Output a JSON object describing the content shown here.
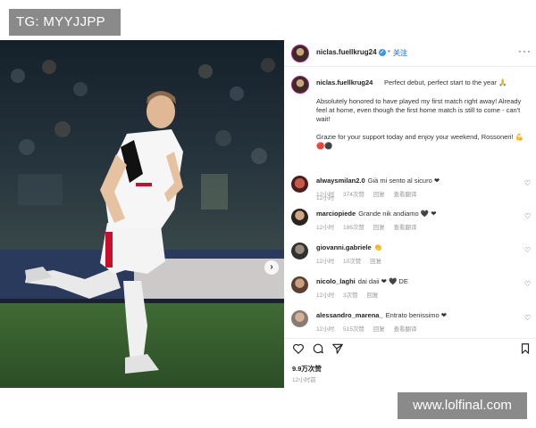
{
  "watermarks": {
    "top": "TG: MYYJJPP",
    "bottom": "www.lolfinal.com"
  },
  "header": {
    "username": "niclas.fuellkrug24",
    "separator": "•",
    "follow_label": "关注",
    "more_icon": "more-horizontal-icon"
  },
  "caption": {
    "username": "niclas.fuellkrug24",
    "first_line": "Perfect debut, perfect start to the year 🙏",
    "paragraph_1": "Absolutely honored to have played my first match right away! Already feel at home, even though the first home match is still to come - can't wait!",
    "paragraph_2": "Grazie for your support today and enjoy your weekend, Rossoneri! 💪🔴⚫",
    "time": "12小时"
  },
  "comments": [
    {
      "username": "alwaysmilan2.0",
      "text": "Già mi sento al sicuro ❤",
      "time": "12小时",
      "likes": "374次赞",
      "reply": "回复",
      "translate": "查看翻译"
    },
    {
      "username": "marciopiede",
      "text": "Grande nik andiamo 🖤 ❤",
      "time": "12小时",
      "likes": "186次赞",
      "reply": "回复",
      "translate": "查看翻译"
    },
    {
      "username": "giovanni.gabriele",
      "text": "👏",
      "time": "12小时",
      "likes": "10次赞",
      "reply": "回复",
      "translate": ""
    },
    {
      "username": "nicolo_laghi",
      "text": "dai daii ❤ 🖤 DE",
      "time": "12小时",
      "likes": "3次赞",
      "reply": "回复",
      "translate": ""
    },
    {
      "username": "alessandro_marena_",
      "text": "Entrato benissimo ❤",
      "time": "12小时",
      "likes": "515次赞",
      "reply": "回复",
      "translate": "查看翻译"
    }
  ],
  "actions": {
    "icons": [
      "heart-icon",
      "comment-icon",
      "share-icon",
      "bookmark-icon"
    ],
    "likes": "9.9万次赞",
    "time": "12小时前"
  },
  "colors": {
    "link": "#3897f0",
    "heart": "#e0245e",
    "kit_red": "#c8102e",
    "kit_black": "#111111"
  }
}
